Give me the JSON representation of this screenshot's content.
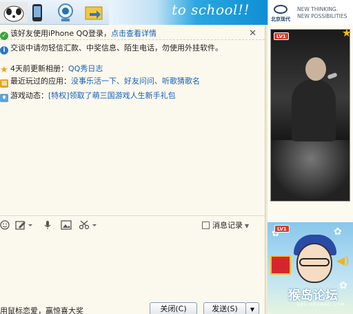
{
  "banner": {
    "text": "to school!!",
    "ad_brand_cn": "北京现代",
    "ad_tagline_1": "NEW THINKING.",
    "ad_tagline_2": "NEW POSSIBILITIES"
  },
  "notices": {
    "iphone_login": "该好友使用iPhone QQ登录，",
    "iphone_link": "点击查看详情",
    "safety": "交谈中请勿轻信汇款、中奖信息、陌生电话，勿使用外挂软件。",
    "album_prefix": "4天前更新相册：",
    "album_link": "QQ秀日志",
    "apps_prefix": "最近玩过的应用：",
    "apps_link": "没事乐活一下、好友问问、听歌猜歌名",
    "game_prefix": "游戏动态：",
    "game_link": "[特权]领取了萌三国游戏人生新手礼包"
  },
  "toolbar": {
    "message_log": "消息记录"
  },
  "bottom": {
    "promo_text": "用鼠标恋爱，赢惊喜大奖",
    "close_label": "关闭(C)",
    "send_label": "发送(S)"
  },
  "right_panel": {
    "level_top": "LV1",
    "level_bottom": "LV1",
    "watermark": "猴岛论坛",
    "watermark_sub": "BBS.HOUDAO.COM"
  },
  "colors": {
    "link": "#1560b5",
    "background": "#fbf8ee",
    "banner_blue": "#0f8fd4"
  }
}
